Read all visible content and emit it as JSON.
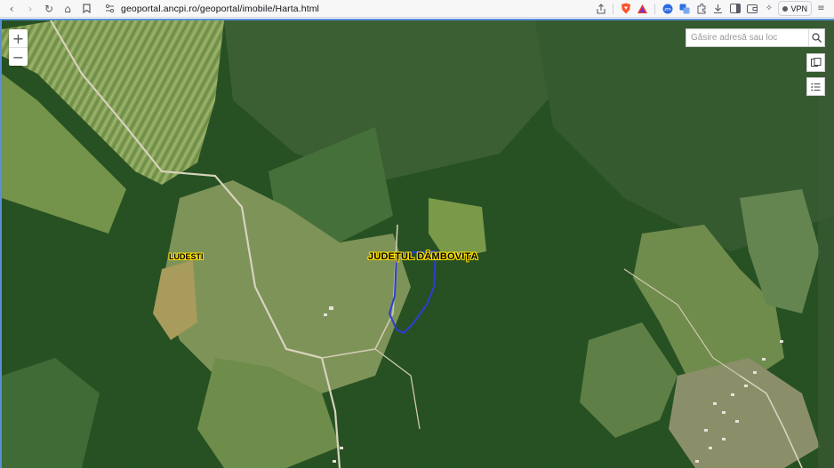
{
  "browser": {
    "url": "geoportal.ancpi.ro/geoportal/imobile/Harta.html",
    "vpn_label": "VPN",
    "icons": [
      "back-icon",
      "forward-icon",
      "reload-icon",
      "home-icon",
      "bookmark-icon",
      "site-info-icon",
      "share-icon",
      "brave-shield-icon",
      "rewards-icon",
      "zoom-ext-icon",
      "translate-icon",
      "extensions-icon",
      "download-icon",
      "sidebar-icon",
      "wallet-icon",
      "leo-icon",
      "menu-icon"
    ]
  },
  "map": {
    "search_placeholder": "Găsire adresă sau loc",
    "zoom_in": "+",
    "zoom_out": "−",
    "labels": {
      "village": "LUDESTI",
      "county": "JUDEȚUL DÂMBOVIȚA"
    },
    "colors": {
      "boundary": "#2b3fd6",
      "label_halo": "#ffe100",
      "selection_border": "#5a8fd8"
    }
  }
}
